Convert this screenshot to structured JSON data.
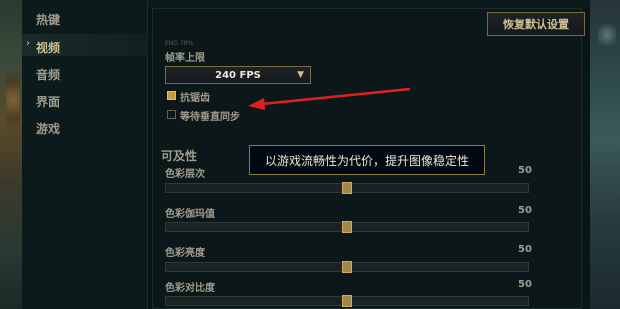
{
  "sidebar": {
    "items": [
      {
        "label": "热键"
      },
      {
        "label": "视频"
      },
      {
        "label": "音频"
      },
      {
        "label": "界面"
      },
      {
        "label": "游戏"
      }
    ],
    "active_index": 1
  },
  "header": {
    "restore_defaults_label": "恢复默认设置",
    "faded_text": "ENG 78%"
  },
  "framerate": {
    "label": "帧率上限",
    "selected": "240 FPS"
  },
  "checkboxes": [
    {
      "label": "抗锯齿",
      "checked": true
    },
    {
      "label": "等待垂直同步",
      "checked": false
    }
  ],
  "accessibility": {
    "title": "可及性"
  },
  "tooltip": {
    "text": "以游戏流畅性为代价，提升图像稳定性"
  },
  "sliders": [
    {
      "label": "色彩层次",
      "value": "50",
      "level": 0.5
    },
    {
      "label": "色彩伽玛值",
      "value": "50",
      "level": 0.5
    },
    {
      "label": "色彩亮度",
      "value": "50",
      "level": 0.5
    },
    {
      "label": "色彩对比度",
      "value": "50",
      "level": 0.5
    }
  ],
  "colors": {
    "gold": "#c89b3c",
    "annotation_arrow": "#e02020"
  }
}
